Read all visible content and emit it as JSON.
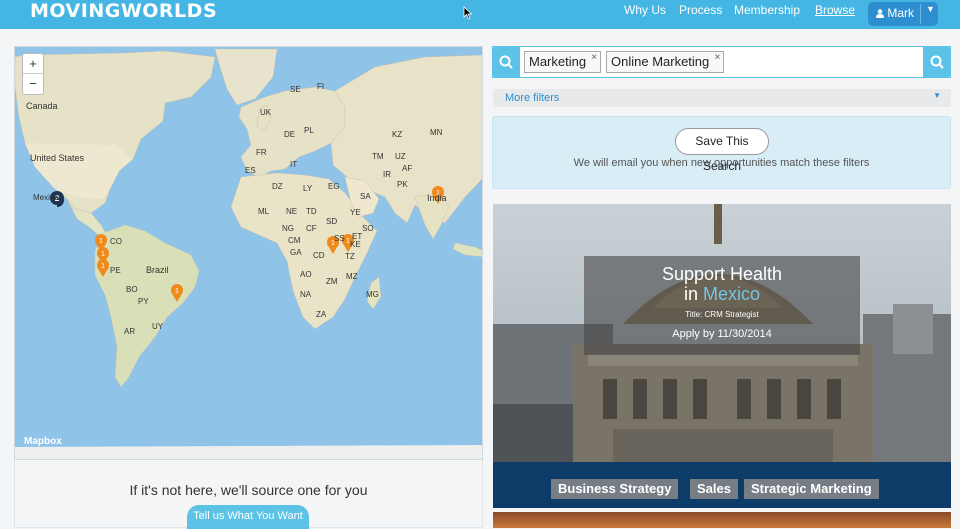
{
  "header": {
    "logo": "MOVINGWORLDS",
    "nav": [
      "Why Us",
      "Process",
      "Membership",
      "Browse"
    ],
    "user": "Mark"
  },
  "map": {
    "zoom_in": "+",
    "zoom_out": "−",
    "attribution": "Mapbox",
    "labels": [
      "Canada",
      "United States",
      "Mexico",
      "Brazil",
      "CO",
      "PE",
      "BO",
      "PY",
      "AR",
      "UY",
      "UK",
      "FR",
      "ES",
      "DE",
      "PL",
      "SE",
      "FI",
      "IT",
      "DZ",
      "LY",
      "EG",
      "SA",
      "ML",
      "NE",
      "TD",
      "SD",
      "ET",
      "SS",
      "NG",
      "CD",
      "TZ",
      "AO",
      "ZM",
      "NA",
      "ZA",
      "MG",
      "IR",
      "AF",
      "PK",
      "India",
      "KZ",
      "MN",
      "TM",
      "UZ",
      "YE",
      "SO",
      "KE",
      "CF",
      "CM",
      "GA",
      "MZ"
    ],
    "markers": [
      {
        "label": "2",
        "kind": "cluster-dark"
      },
      {
        "label": "1",
        "kind": "pin"
      },
      {
        "label": "1",
        "kind": "pin"
      },
      {
        "label": "1",
        "kind": "pin"
      },
      {
        "label": "1",
        "kind": "pin"
      },
      {
        "label": "1",
        "kind": "pin"
      },
      {
        "label": "1",
        "kind": "pin"
      },
      {
        "label": "1",
        "kind": "pin"
      }
    ]
  },
  "source": {
    "text": "If it's not here, we'll source one for you",
    "button": "Tell us What You Want"
  },
  "search": {
    "tags": [
      "Marketing",
      "Online Marketing"
    ],
    "remove": "×"
  },
  "filters": {
    "more": "More filters"
  },
  "save": {
    "button": "Save This Search",
    "note": "We will email you when new opportunities match these filters"
  },
  "opportunity": {
    "title_line1": "Support Health",
    "title_in": "in",
    "country": "Mexico",
    "subtitle": "Title: CRM Strategist",
    "apply": "Apply by 11/30/2014",
    "categories": [
      "Business Strategy",
      "Sales",
      "Strategic Marketing"
    ]
  },
  "colors": {
    "brand": "#45b6e3",
    "navy": "#0d3c68",
    "pin": "#f08a1c",
    "tag_gray": "#767d84"
  }
}
